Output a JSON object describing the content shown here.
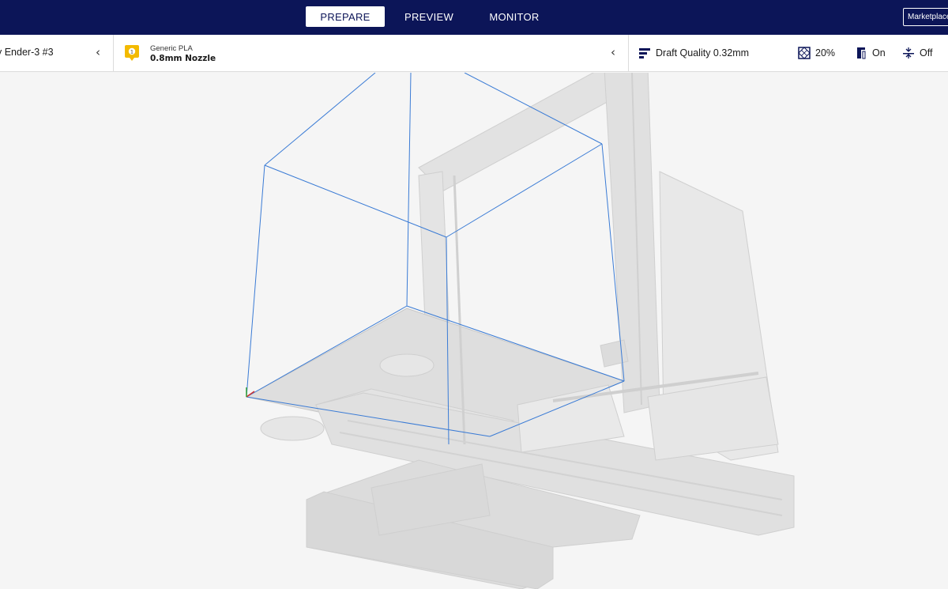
{
  "header": {
    "tabs": [
      {
        "label": "PREPARE",
        "active": true
      },
      {
        "label": "PREVIEW",
        "active": false
      },
      {
        "label": "MONITOR",
        "active": false
      }
    ],
    "marketplace_label": "Marketplace"
  },
  "toolbar": {
    "printer": {
      "name": "y Ender-3 #3"
    },
    "material": {
      "name": "Generic PLA",
      "nozzle": "0.8mm Nozzle",
      "badge_color": "#f3ba00",
      "badge_number": "1"
    },
    "print_settings": {
      "quality": "Draft Quality 0.32mm",
      "infill": "20%",
      "support": "On",
      "adhesion": "Off"
    }
  },
  "colors": {
    "header_bg": "#0c1558",
    "build_volume_lines": "#3a7bd5"
  },
  "icons": {
    "quality": "quality-bars-icon",
    "infill": "infill-icon",
    "support": "support-icon",
    "adhesion": "adhesion-icon"
  }
}
